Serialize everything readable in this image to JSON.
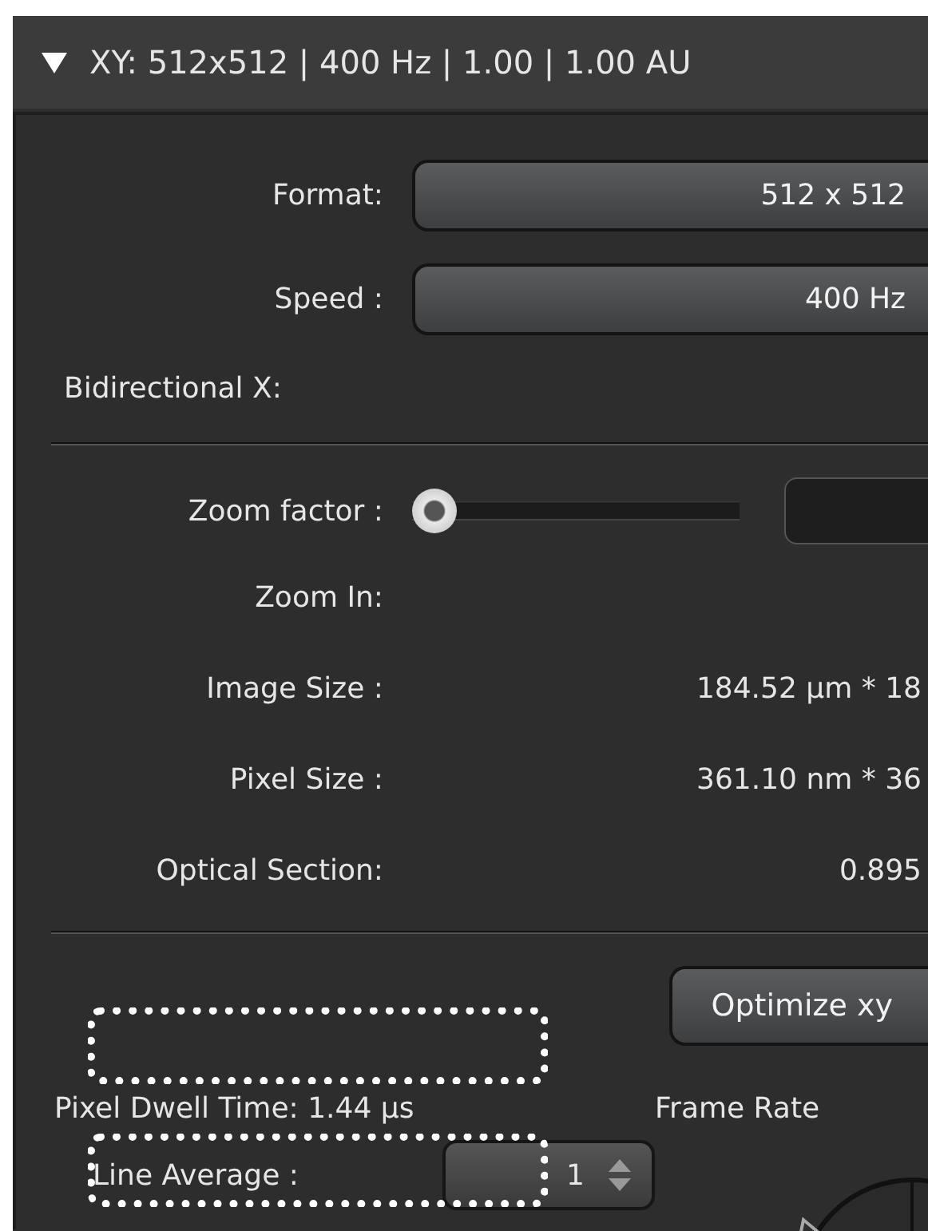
{
  "section": {
    "title": "XY: 512x512 | 400 Hz | 1.00 | 1.00 AU",
    "expanded": true
  },
  "fields": [
    {
      "kind": "dropdown",
      "label": "Format:",
      "value": "512 x 512"
    },
    {
      "kind": "dropdown",
      "label": "Speed :",
      "value": "400 Hz"
    },
    {
      "kind": "wide",
      "label": "Bidirectional X:"
    },
    {
      "kind": "separator"
    },
    {
      "kind": "slider",
      "label": "Zoom factor :",
      "level": 0
    },
    {
      "kind": "text",
      "label": "Zoom In:"
    },
    {
      "kind": "text",
      "label": "Image Size :",
      "value": "184.52 µm * 18"
    },
    {
      "kind": "text",
      "label": "Pixel Size :",
      "value": "361.10 nm * 36"
    },
    {
      "kind": "text",
      "label": "Optical Section:",
      "value": "0.895"
    },
    {
      "kind": "separator"
    }
  ],
  "optimize_button": "Optimize xy",
  "pixel_dwell_time": "Pixel Dwell Time: 1.44 µs",
  "frame_rate_label": "Frame Rate",
  "line_average": {
    "label": "Line Average :",
    "value": "1"
  }
}
